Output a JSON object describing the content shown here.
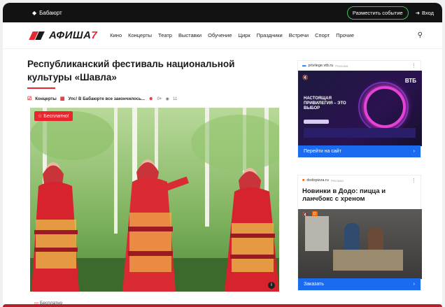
{
  "topbar": {
    "city": "Бабаюрт",
    "place_event": "Разместить событие",
    "login": "Вход"
  },
  "nav": {
    "logo_text": "АФИША",
    "logo_suffix": "7",
    "items": [
      "Кино",
      "Концерты",
      "Театр",
      "Выставки",
      "Обучение",
      "Цирк",
      "Праздники",
      "Встречи",
      "Спорт",
      "Прочие"
    ]
  },
  "event": {
    "title": "Республиканский фестиваль национальной культуры «Шавла»",
    "category": "Концерты",
    "date_status": "Упс! В Бабаюрте все закончилось...",
    "age": "0+",
    "views": "11",
    "badge": "☆ Бесплатно!",
    "price": "Бесплатно"
  },
  "ad1": {
    "domain": "privilege.vtb.ru",
    "tag": "Реклама",
    "brand": "ВТБ",
    "headline": "НАСТОЯЩАЯ ПРИВИЛЕГИЯ – ЭТО ВЫБОР",
    "cta": "Перейти на сайт"
  },
  "ad2": {
    "domain": "dodopizza.ru",
    "tag": "Реклама",
    "headline": "Новинки в Додо: пицца и ланчбокс с хреном",
    "cta": "Заказать"
  },
  "colors": {
    "accent": "#e8262f",
    "ad_button": "#1b6bf0",
    "topbar": "#121212",
    "place_btn_border": "#3ec15e"
  }
}
